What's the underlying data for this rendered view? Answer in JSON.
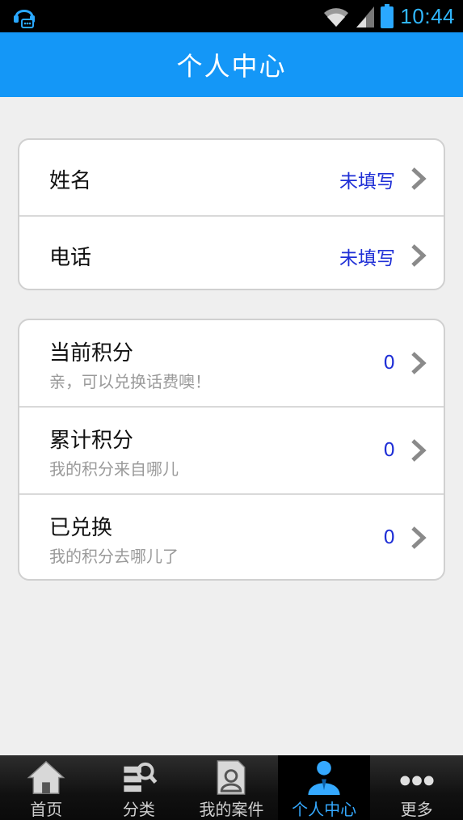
{
  "status_bar": {
    "time": "10:44",
    "left_icon": "notification-headset-icon",
    "icons": [
      "wifi-icon",
      "signal-icon",
      "battery-icon"
    ]
  },
  "header": {
    "title": "个人中心"
  },
  "profile_card": {
    "rows": [
      {
        "label": "姓名",
        "value": "未填写"
      },
      {
        "label": "电话",
        "value": "未填写"
      }
    ]
  },
  "points_card": {
    "rows": [
      {
        "label": "当前积分",
        "sub": "亲，可以兑换话费噢！",
        "value": "0"
      },
      {
        "label": "累计积分",
        "sub": "我的积分来自哪儿",
        "value": "0"
      },
      {
        "label": "已兑换",
        "sub": "我的积分去哪儿了",
        "value": "0"
      }
    ]
  },
  "tabbar": {
    "tabs": [
      {
        "label": "首页",
        "icon": "home-icon"
      },
      {
        "label": "分类",
        "icon": "category-search-icon"
      },
      {
        "label": "我的案件",
        "icon": "case-document-icon"
      },
      {
        "label": "个人中心",
        "icon": "user-profile-icon",
        "active": true
      },
      {
        "label": "更多",
        "icon": "more-dots-icon"
      }
    ]
  },
  "colors": {
    "header": "#1497f7",
    "value_text": "#1f2fd6",
    "active_tab": "#35a9ff",
    "time": "#30b7ff"
  }
}
